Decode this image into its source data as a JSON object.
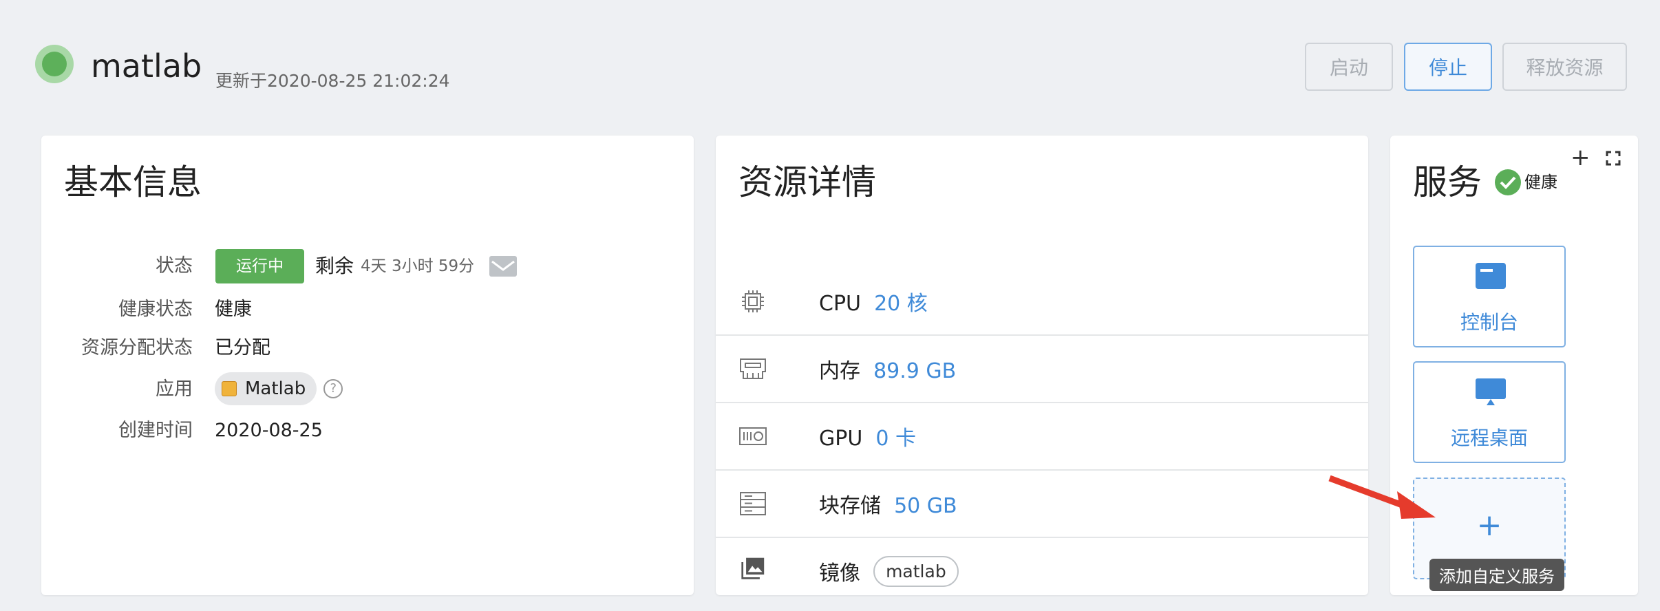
{
  "header": {
    "title": "matlab",
    "updated": "更新于2020-08-25 21:02:24",
    "buttons": {
      "start": "启动",
      "stop": "停止",
      "release": "释放资源"
    },
    "status_color": "#5db05a"
  },
  "basic_info": {
    "title": "基本信息",
    "rows": [
      {
        "label": "状态",
        "value": "运行中"
      },
      {
        "label": "健康状态",
        "value": "健康"
      },
      {
        "label": "资源分配状态",
        "value": "已分配"
      },
      {
        "label": "应用",
        "value": "Matlab"
      },
      {
        "label": "创建时间",
        "value": "2020-08-25"
      }
    ],
    "remaining_label": "剩余",
    "remaining_value": "4天 3小时 59分"
  },
  "resources": {
    "title": "资源详情",
    "items": [
      {
        "label": "CPU",
        "value": "20 核",
        "icon": "cpu-icon"
      },
      {
        "label": "内存",
        "value": "89.9 GB",
        "icon": "memory-icon"
      },
      {
        "label": "GPU",
        "value": "0 卡",
        "icon": "gpu-icon"
      },
      {
        "label": "块存储",
        "value": "50 GB",
        "icon": "storage-icon"
      },
      {
        "label": "镜像",
        "value": "matlab",
        "icon": "image-icon"
      }
    ]
  },
  "services": {
    "title": "服务",
    "health": "健康",
    "tiles": [
      {
        "label": "控制台",
        "icon": "console-icon"
      },
      {
        "label": "远程桌面",
        "icon": "monitor-icon"
      }
    ],
    "add_plus": "+",
    "add_tooltip": "添加自定义服务",
    "top_plus": "+"
  },
  "colors": {
    "accent": "#3f8ad8",
    "running": "#5bae58",
    "annotation_arrow": "#e53b2c"
  }
}
